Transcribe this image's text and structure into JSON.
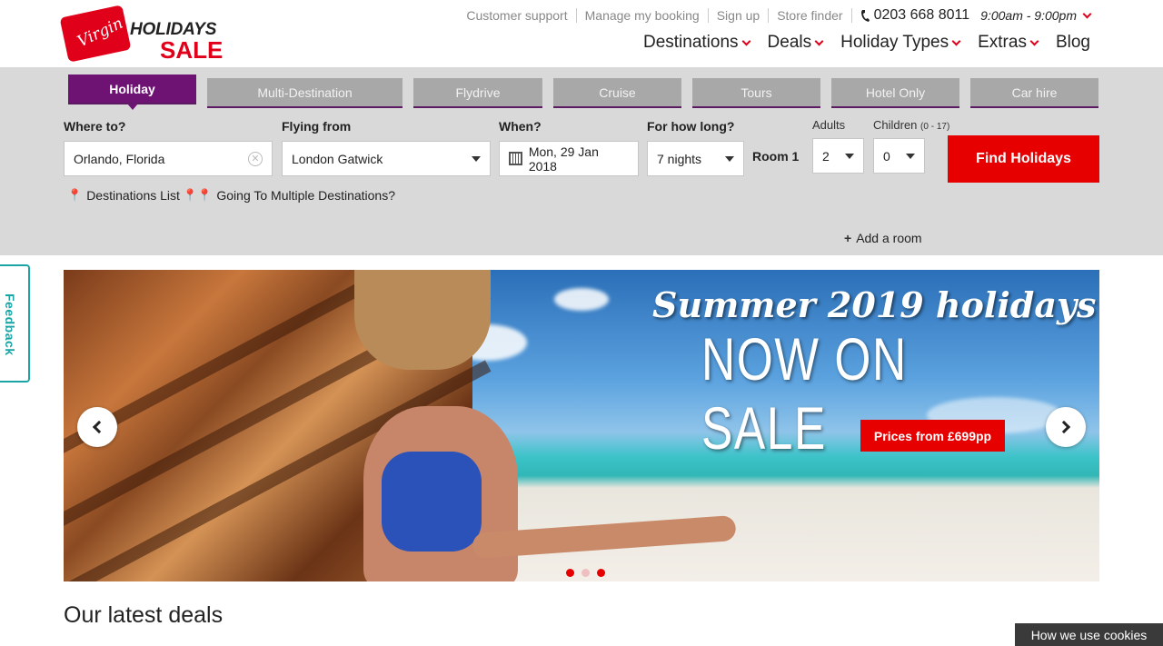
{
  "brand": {
    "logo_virgin": "Virgin",
    "logo_holidays": "HOLIDAYS",
    "logo_sale": "SALE",
    "primary_color": "#e1001a",
    "accent_color": "#6e1273"
  },
  "topbar": {
    "links": [
      "Customer support",
      "Manage my booking",
      "Sign up",
      "Store finder"
    ],
    "phone_icon": "phone-icon",
    "phone": "0203 668 8011",
    "hours": "9:00am - 9:00pm"
  },
  "mainnav": {
    "items": [
      "Destinations",
      "Deals",
      "Holiday Types",
      "Extras",
      "Blog"
    ]
  },
  "search": {
    "tabs": [
      "Holiday",
      "Multi-Destination",
      "Flydrive",
      "Cruise",
      "Tours",
      "Hotel Only",
      "Car hire"
    ],
    "active_tab": "Holiday",
    "where_label": "Where to?",
    "where_value": "Orlando, Florida",
    "flying_label": "Flying from",
    "flying_value": "London Gatwick",
    "when_label": "When?",
    "when_value": "Mon, 29 Jan 2018",
    "howlong_label": "For how long?",
    "howlong_value": "7 nights",
    "room_label": "Room 1",
    "adults_label": "Adults",
    "adults_value": "2",
    "children_label": "Children",
    "children_range": "(0 - 17)",
    "children_value": "0",
    "find_button": "Find Holidays",
    "destinations_list": "Destinations List",
    "multiple_destinations": "Going To Multiple Destinations?",
    "add_room": "Add a room"
  },
  "feedback": {
    "label": "Feedback"
  },
  "hero": {
    "title_line1": "Summer 2019 holidays",
    "title_line2": "NOW ON SALE",
    "price_button": "Prices from £699pp",
    "slides_total": 3,
    "active_slide": 1
  },
  "sections": {
    "latest_deals": "Our latest deals"
  },
  "cookie_banner": {
    "label": "How we use cookies"
  }
}
